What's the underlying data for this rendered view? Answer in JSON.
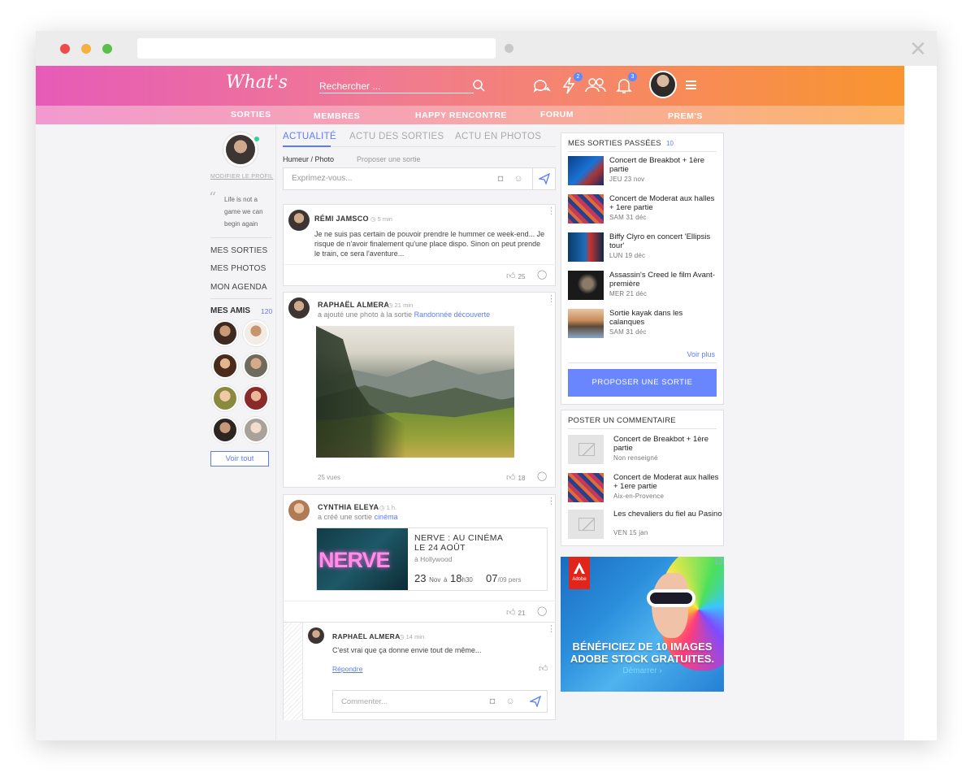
{
  "header": {
    "logo": "What's",
    "search_placeholder": "Rechercher ...",
    "badges": {
      "activity": "2",
      "notifications": "3"
    }
  },
  "subnav": [
    "SORTIES",
    "MEMBRES",
    "HAPPY RENCONTRE",
    "FORUM",
    "PREM'S"
  ],
  "sidebar": {
    "edit_profile": "MODIFIER LE PROFIL",
    "quote": "Life is not a game we can begin again",
    "links": [
      "MES SORTIES",
      "MES PHOTOS",
      "MON AGENDA"
    ],
    "friends_label": "MES AMIS",
    "friends_count": "120",
    "see_all": "Voir tout"
  },
  "feed": {
    "tabs": [
      "ACTUALITÉ",
      "ACTU DES SORTIES",
      "ACTU EN PHOTOS"
    ],
    "subtabs": [
      "Humeur / Photo",
      "Proposer une sortie"
    ],
    "composer_placeholder": "Exprimez-vous...",
    "posts": [
      {
        "author": "RÉMI JAMSCO",
        "time": "5 min",
        "text": "Je ne suis pas certain de pouvoir prendre le hummer ce week-end... Je risque de n'avoir finalement qu'une place dispo. Sinon on peut prende le train, ce sera l'aventure...",
        "likes": "25"
      },
      {
        "author": "RAPHAËL ALMERA",
        "time": "21 min",
        "action": "a ajouté une photo à la sortie",
        "action_link": "Randonnée découverte",
        "views": "25 vues",
        "likes": "18"
      },
      {
        "author": "CYNTHIA ELEYA",
        "time": "1 h.",
        "action": "a créé une sortie",
        "action_link": "cinéma",
        "event": {
          "image_text": "NERVE",
          "title_line1": "NERVE : AU CINÉMA",
          "title_line2": "LE 24 AOÛT",
          "location": "à Hollywood",
          "day": "23",
          "month": "Nov",
          "at": "à",
          "hour": "18",
          "min": "h30",
          "persons": "07",
          "persons_total": "/09 pers"
        },
        "likes": "21"
      }
    ],
    "reply": {
      "author": "RAPHAËL ALMERA",
      "time": "14 min",
      "text": "C'est vrai que ça donne envie tout de même...",
      "reply_link": "Répondre",
      "comment_placeholder": "Commenter..."
    }
  },
  "right": {
    "past_title": "MES SORTIES PASSÉES",
    "past_count": "10",
    "past": [
      {
        "title": "Concert de Breakbot + 1ère partie",
        "date": "JEU 23 nov"
      },
      {
        "title": "Concert de Moderat aux halles + 1ere partie",
        "date": "SAM 31 déc"
      },
      {
        "title": "Biffy Clyro en concert 'Ellipsis tour'",
        "date": "LUN 19 déc"
      },
      {
        "title": "Assassin's Creed le film Avant-première",
        "date": "MER 21 déc"
      },
      {
        "title": "Sortie kayak dans les calanques",
        "date": "SAM 31 déc"
      }
    ],
    "see_more": "Voir plus",
    "propose": "PROPOSER UNE SORTIE",
    "comment_title": "POSTER UN COMMENTAIRE",
    "comment_items": [
      {
        "title": "Concert de Breakbot + 1ère partie",
        "sub": "Non renseigné"
      },
      {
        "title": "Concert de Moderat aux halles + 1ere partie",
        "sub": "Aix-en-Provence"
      },
      {
        "title": "Les chevaliers du fiel au Pasino",
        "sub": "VEN 15 jan"
      }
    ],
    "ad": {
      "brand": "Adobe",
      "text_line1": "BÉNÉFICIEZ DE 10 IMAGES",
      "text_line2": "ADOBE STOCK GRATUITES.",
      "cta": "Démarrer ›"
    }
  }
}
